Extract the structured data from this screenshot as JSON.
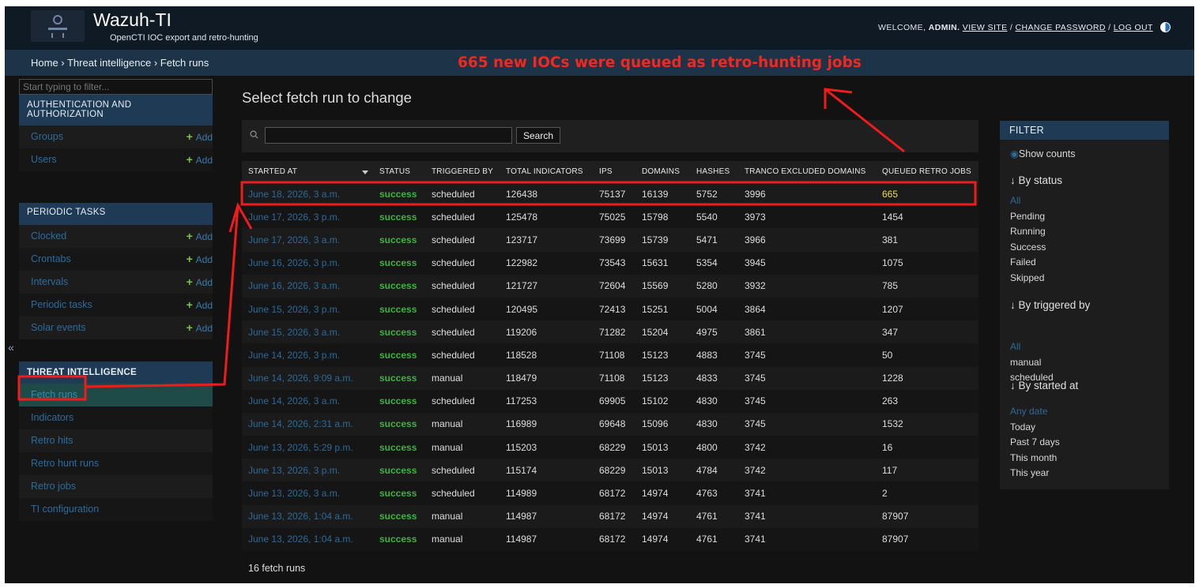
{
  "header": {
    "brand": "Wazuh-TI",
    "subtitle": "OpenCTI IOC export and retro-hunting",
    "welcome": "WELCOME,",
    "username": "ADMIN.",
    "view_site": "VIEW SITE",
    "sep": "/",
    "change_password": "CHANGE PASSWORD",
    "log_out": "LOG OUT"
  },
  "breadcrumb": "Home › Threat intelligence › Fetch runs",
  "message": "665 new IOCs were queued as retro-hunting jobs",
  "sidebar": {
    "filter_placeholder": "Start typing to filter...",
    "collapse": "«",
    "add_label": "Add",
    "modules": [
      {
        "caption": "AUTHENTICATION AND AUTHORIZATION",
        "items": [
          "Groups",
          "Users"
        ]
      },
      {
        "caption": "PERIODIC TASKS",
        "items": [
          "Clocked",
          "Crontabs",
          "Intervals",
          "Periodic tasks",
          "Solar events"
        ]
      },
      {
        "caption": "THREAT INTELLIGENCE",
        "items": [
          "Fetch runs",
          "Indicators",
          "Retro hits",
          "Retro hunt runs",
          "Retro jobs",
          "TI configuration"
        ]
      }
    ]
  },
  "main": {
    "title": "Select fetch run to change",
    "search_button": "Search",
    "columns": [
      "STARTED AT",
      "STATUS",
      "TRIGGERED BY",
      "TOTAL INDICATORS",
      "IPS",
      "DOMAINS",
      "HASHES",
      "TRANCO EXCLUDED DOMAINS",
      "QUEUED RETRO JOBS"
    ],
    "rows": [
      [
        "June 18, 2026, 3 a.m.",
        "success",
        "scheduled",
        "126438",
        "75137",
        "16139",
        "5752",
        "3996",
        "665"
      ],
      [
        "June 17, 2026, 3 p.m.",
        "success",
        "scheduled",
        "125478",
        "75025",
        "15798",
        "5540",
        "3973",
        "1454"
      ],
      [
        "June 17, 2026, 3 a.m.",
        "success",
        "scheduled",
        "123717",
        "73699",
        "15739",
        "5471",
        "3966",
        "381"
      ],
      [
        "June 16, 2026, 3 p.m.",
        "success",
        "scheduled",
        "122982",
        "73543",
        "15631",
        "5354",
        "3945",
        "1075"
      ],
      [
        "June 16, 2026, 3 a.m.",
        "success",
        "scheduled",
        "121727",
        "72604",
        "15569",
        "5280",
        "3932",
        "785"
      ],
      [
        "June 15, 2026, 3 p.m.",
        "success",
        "scheduled",
        "120495",
        "72413",
        "15251",
        "5004",
        "3864",
        "1207"
      ],
      [
        "June 15, 2026, 3 a.m.",
        "success",
        "scheduled",
        "119206",
        "71282",
        "15204",
        "4975",
        "3861",
        "347"
      ],
      [
        "June 14, 2026, 3 p.m.",
        "success",
        "scheduled",
        "118528",
        "71108",
        "15123",
        "4883",
        "3745",
        "50"
      ],
      [
        "June 14, 2026, 9:09 a.m.",
        "success",
        "manual",
        "118479",
        "71108",
        "15123",
        "4833",
        "3745",
        "1228"
      ],
      [
        "June 14, 2026, 3 a.m.",
        "success",
        "scheduled",
        "117253",
        "69905",
        "15102",
        "4830",
        "3745",
        "263"
      ],
      [
        "June 14, 2026, 2:31 a.m.",
        "success",
        "manual",
        "116989",
        "69648",
        "15096",
        "4830",
        "3745",
        "1532"
      ],
      [
        "June 13, 2026, 5:29 p.m.",
        "success",
        "manual",
        "115203",
        "68229",
        "15013",
        "4800",
        "3742",
        "16"
      ],
      [
        "June 13, 2026, 3 p.m.",
        "success",
        "scheduled",
        "115174",
        "68229",
        "15013",
        "4784",
        "3742",
        "117"
      ],
      [
        "June 13, 2026, 3 a.m.",
        "success",
        "scheduled",
        "114989",
        "68172",
        "14974",
        "4763",
        "3741",
        "2"
      ],
      [
        "June 13, 2026, 1:04 a.m.",
        "success",
        "manual",
        "114987",
        "68172",
        "14974",
        "4761",
        "3741",
        "87907"
      ],
      [
        "June 13, 2026, 1:04 a.m.",
        "success",
        "manual",
        "114987",
        "68172",
        "14974",
        "4761",
        "3741",
        "87907"
      ]
    ],
    "count": "16 fetch runs"
  },
  "filter": {
    "title": "FILTER",
    "show_counts": "Show counts",
    "groups": [
      {
        "title": "↓ By status",
        "options": [
          "All",
          "Pending",
          "Running",
          "Success",
          "Failed",
          "Skipped"
        ]
      },
      {
        "title": "↓ By triggered by",
        "options": [
          "All",
          "manual",
          "scheduled"
        ]
      },
      {
        "title": "↓ By started at",
        "options": [
          "Any date",
          "Today",
          "Past 7 days",
          "This month",
          "This year"
        ]
      }
    ]
  },
  "colors": {
    "accent": "#1e3a55",
    "link": "#2d6a98",
    "success": "#3fb340",
    "annotation": "#f0281f",
    "highlight": "#ecdc4a"
  }
}
